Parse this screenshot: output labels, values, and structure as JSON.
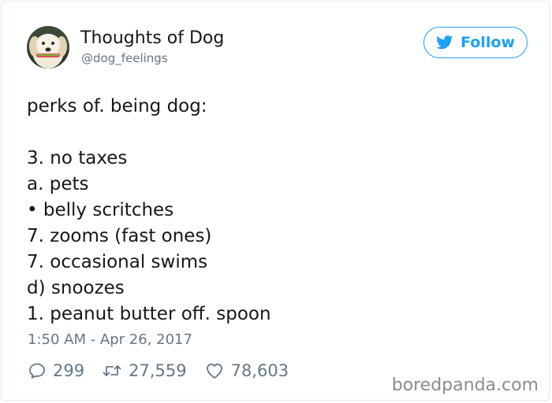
{
  "user": {
    "display_name": "Thoughts of Dog",
    "handle": "@dog_feelings",
    "avatar_icon": "dog-avatar"
  },
  "follow_button": {
    "label": "Follow",
    "icon": "twitter-bird-icon",
    "color": "#1da1f2"
  },
  "tweet": {
    "lines": [
      "perks of. being dog:",
      "",
      "3. no taxes",
      "a. pets",
      "• belly scritches",
      "7. zooms (fast ones)",
      "7. occasional swims",
      "d) snoozes",
      "1. peanut butter off. spoon"
    ],
    "timestamp": "1:50 AM - Apr 26, 2017"
  },
  "actions": {
    "replies": "299",
    "retweets": "27,559",
    "likes": "78,603"
  },
  "watermark": "boredpanda.com"
}
